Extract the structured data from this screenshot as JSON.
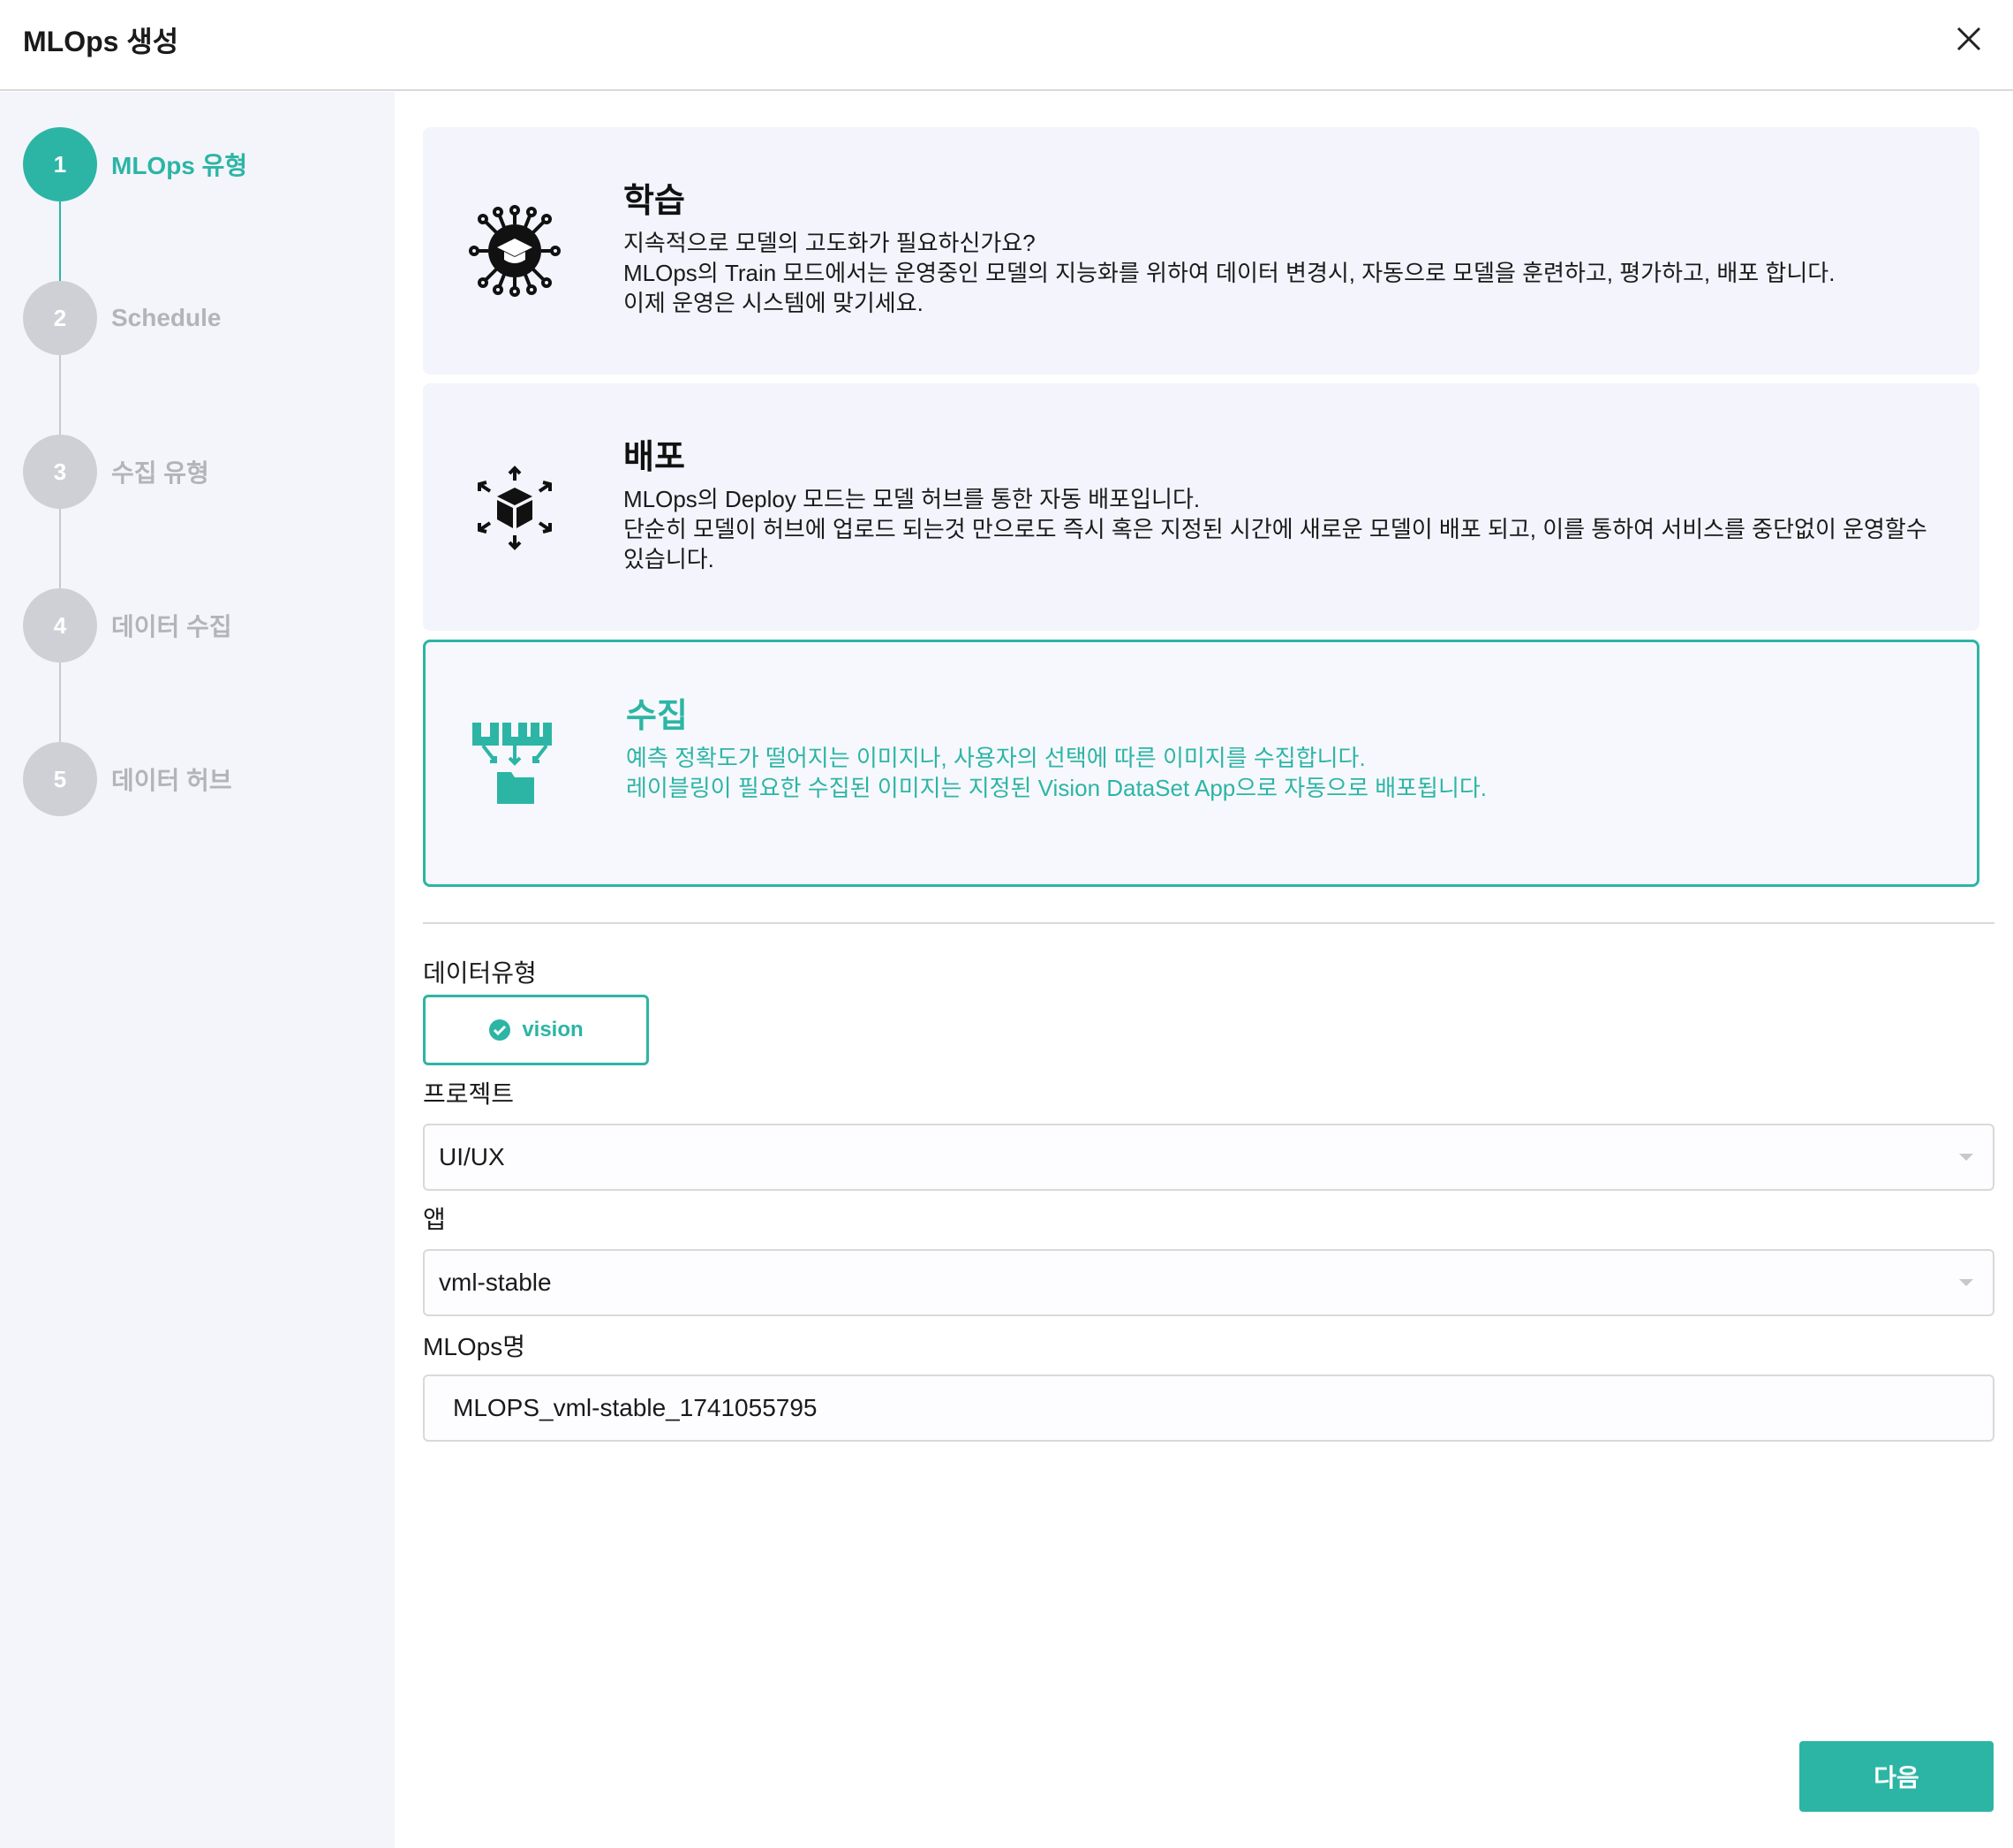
{
  "dialog": {
    "title": "MLOps 생성",
    "close_icon": "close-icon"
  },
  "steps": [
    {
      "number": "1",
      "label": "MLOps 유형",
      "active": true
    },
    {
      "number": "2",
      "label": "Schedule",
      "active": false
    },
    {
      "number": "3",
      "label": "수집 유형",
      "active": false
    },
    {
      "number": "4",
      "label": "데이터 수집",
      "active": false
    },
    {
      "number": "5",
      "label": "데이터 허브",
      "active": false
    }
  ],
  "cards": [
    {
      "title": "학습",
      "icon": "graduation-network-icon",
      "lines": [
        "지속적으로 모델의 고도화가 필요하신가요?",
        "MLOps의 Train 모드에서는 운영중인 모델의 지능화를 위하여 데이터 변경시, 자동으로 모델을 훈련하고, 평가하고, 배포 합니다.",
        "이제 운영은 시스템에 맞기세요."
      ],
      "selected": false
    },
    {
      "title": "배포",
      "icon": "cube-distribute-icon",
      "lines": [
        "MLOps의 Deploy 모드는 모델 허브를 통한 자동 배포입니다.",
        "단순히 모델이 허브에 업로드 되는것 만으로도 즉시 혹은 지정된 시간에 새로운 모델이 배포 되고, 이를 통하여 서비스를 중단없이 운영할수 있습니다."
      ],
      "selected": false
    },
    {
      "title": "수집",
      "icon": "collect-folder-icon",
      "lines": [
        "예측 정확도가 떨어지는 이미지나, 사용자의 선택에 따른 이미지를 수집합니다.",
        "레이블링이 필요한 수집된 이미지는 지정된 Vision DataSet App으로 자동으로 배포됩니다."
      ],
      "selected": true
    }
  ],
  "form": {
    "data_type_label": "데이터유형",
    "data_type_value": "vision",
    "project_label": "프로젝트",
    "project_value": "UI/UX",
    "app_label": "앱",
    "app_value": "vml-stable",
    "name_label": "MLOps명",
    "name_value": "MLOPS_vml-stable_1741055795"
  },
  "footer": {
    "next_label": "다음"
  },
  "colors": {
    "accent": "#2cb5a5",
    "sidebar_bg": "#f4f5fb",
    "card_bg": "#f3f4fc",
    "inactive_step": "#cfd0d6"
  }
}
